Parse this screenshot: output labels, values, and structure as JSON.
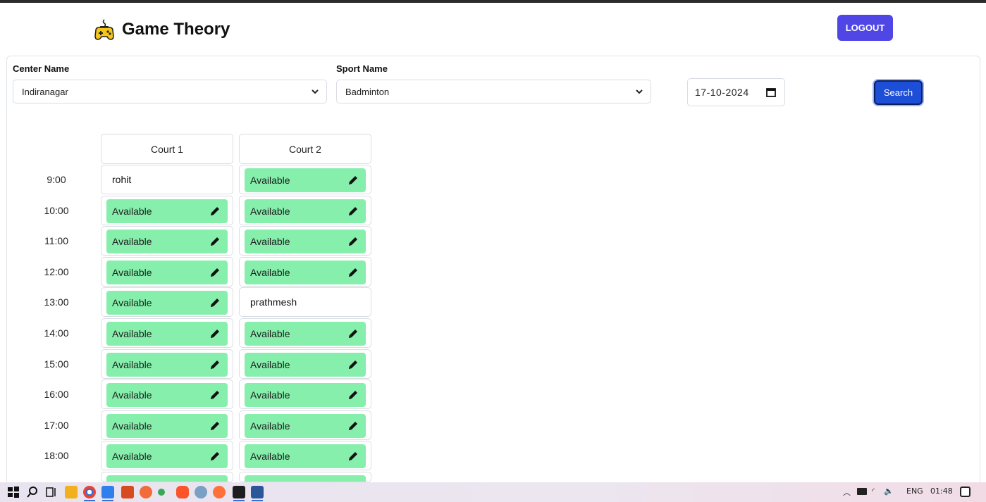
{
  "app": {
    "title": "Game Theory",
    "logout_label": "LOGOUT"
  },
  "filters": {
    "center_label": "Center Name",
    "center_value": "Indiranagar",
    "sport_label": "Sport Name",
    "sport_value": "Badminton",
    "date_value": "17-10-2024",
    "search_label": "Search"
  },
  "courts": [
    "Court 1",
    "Court 2"
  ],
  "slots": [
    {
      "time": "9:00",
      "cells": [
        "rohit",
        "Available"
      ]
    },
    {
      "time": "10:00",
      "cells": [
        "Available",
        "Available"
      ]
    },
    {
      "time": "11:00",
      "cells": [
        "Available",
        "Available"
      ]
    },
    {
      "time": "12:00",
      "cells": [
        "Available",
        "Available"
      ]
    },
    {
      "time": "13:00",
      "cells": [
        "Available",
        "prathmesh"
      ]
    },
    {
      "time": "14:00",
      "cells": [
        "Available",
        "Available"
      ]
    },
    {
      "time": "15:00",
      "cells": [
        "Available",
        "Available"
      ]
    },
    {
      "time": "16:00",
      "cells": [
        "Available",
        "Available"
      ]
    },
    {
      "time": "17:00",
      "cells": [
        "Available",
        "Available"
      ]
    },
    {
      "time": "18:00",
      "cells": [
        "Available",
        "Available"
      ]
    }
  ],
  "colors": {
    "available": "#86efac",
    "logout": "#4f46e5",
    "search": "#1d4ed8"
  },
  "taskbar": {
    "tray_language": "ENG",
    "tray_time": "01:48"
  }
}
